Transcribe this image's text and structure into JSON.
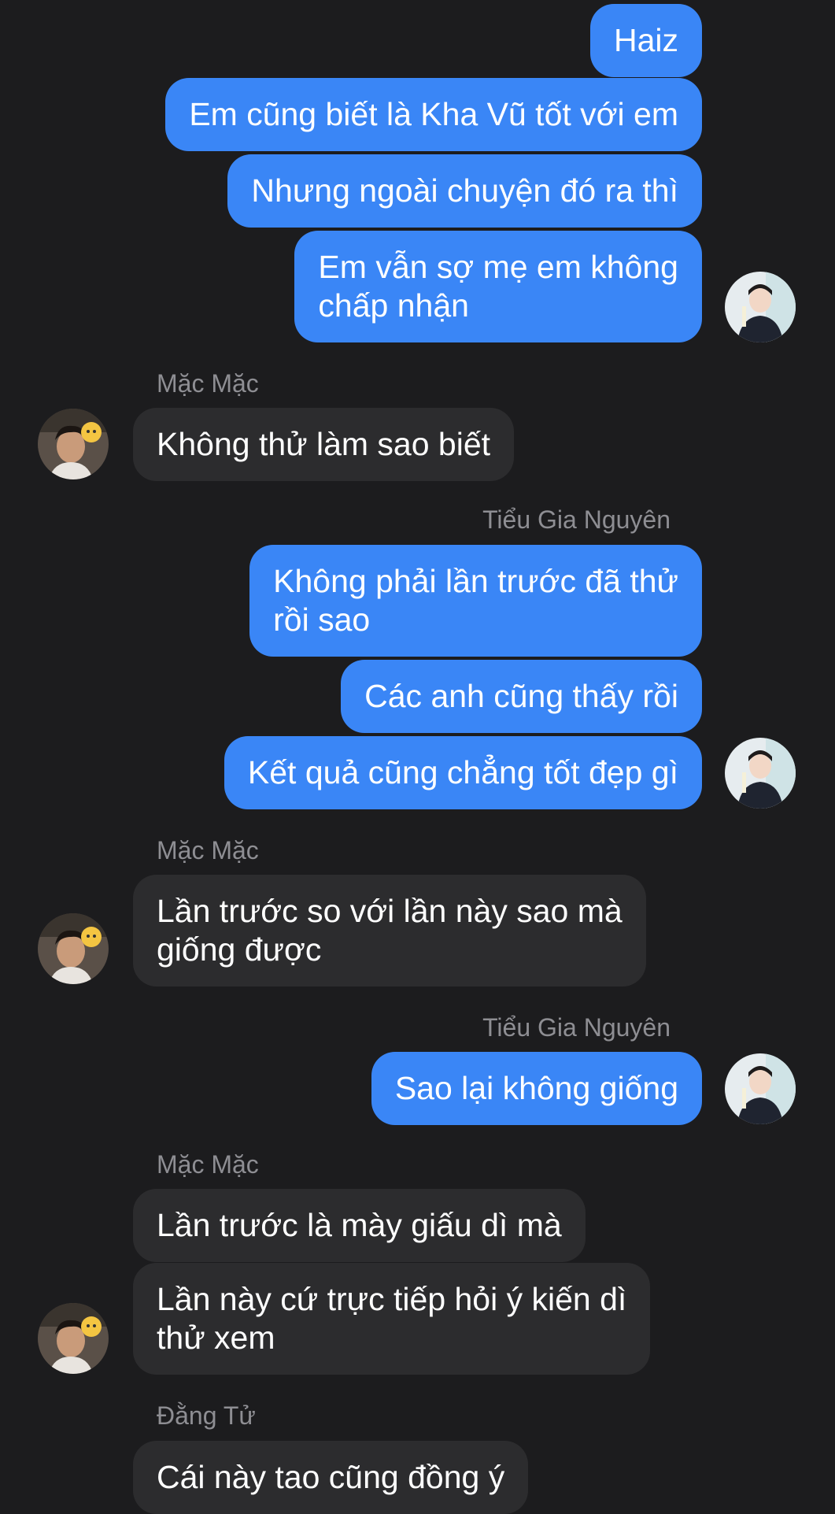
{
  "conversation": {
    "messages": [
      {
        "sender": "me",
        "text": "Haiz"
      },
      {
        "sender": "me",
        "text": "Em cũng biết là Kha Vũ tốt với em"
      },
      {
        "sender": "me",
        "text": "Nhưng ngoài chuyện đó ra thì"
      },
      {
        "sender": "me",
        "lines": [
          "Em vẫn sợ mẹ em không",
          "chấp nhận"
        ]
      },
      {
        "sender_name": "Mặc Mặc",
        "text": "Không thử làm sao biết"
      },
      {
        "sender_name": "Tiểu Gia Nguyên",
        "lines": [
          "Không phải lần trước đã thử",
          "rồi sao"
        ]
      },
      {
        "sender": "me",
        "text": "Các anh cũng thấy rồi"
      },
      {
        "sender": "me",
        "text": "Kết quả cũng chẳng tốt đẹp gì"
      },
      {
        "sender_name": "Mặc Mặc",
        "lines": [
          "Lần trước so với lần này sao mà",
          "giống được"
        ]
      },
      {
        "sender_name": "Tiểu Gia Nguyên",
        "text": "Sao lại không giống"
      },
      {
        "sender_name": "Mặc Mặc",
        "text": "Lần trước là mày giấu dì mà"
      },
      {
        "sender": "Mặc Mặc",
        "lines": [
          "Lần này cứ trực tiếp hỏi ý kiến dì",
          "thử xem"
        ]
      },
      {
        "sender_name": "Đằng Tử",
        "text": "Cái này tao cũng đồng ý"
      }
    ]
  },
  "names": {
    "mac_mac_1": "Mặc Mặc",
    "tieu_gia_nguyen_1": "Tiểu Gia Nguyên",
    "mac_mac_2": "Mặc Mặc",
    "tieu_gia_nguyen_2": "Tiểu Gia Nguyên",
    "mac_mac_3": "Mặc Mặc",
    "dang_tu": "Đằng Tử"
  },
  "bubbles": {
    "b1": "Haiz",
    "b2": "Em cũng biết là Kha Vũ tốt với em",
    "b3": "Nhưng ngoài chuyện đó ra thì",
    "b4_l1": "Em vẫn sợ mẹ em không",
    "b4_l2": "chấp nhận",
    "b5": "Không thử làm sao biết",
    "b6_l1": "Không phải lần trước đã thử",
    "b6_l2": "rồi sao",
    "b7": "Các anh cũng thấy rồi",
    "b8": "Kết quả cũng chẳng tốt đẹp gì",
    "b9_l1": "Lần trước so với lần này sao mà",
    "b9_l2": "giống được",
    "b10": "Sao lại không giống",
    "b11": "Lần trước là mày giấu dì mà",
    "b12_l1": "Lần này cứ trực tiếp hỏi ý kiến dì",
    "b12_l2": "thử xem",
    "b13": "Cái này tao cũng đồng ý"
  },
  "colors": {
    "background": "#1c1c1e",
    "outgoing_bubble": "#3a86f6",
    "incoming_bubble": "#2c2c2e",
    "sender_name": "#8e8e93"
  }
}
